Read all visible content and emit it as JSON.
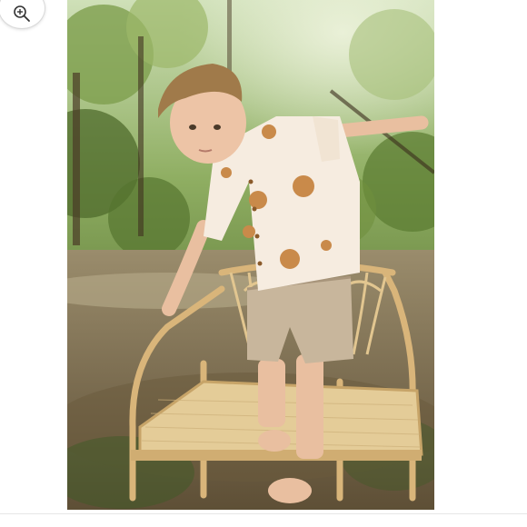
{
  "viewer": {
    "zoom_button": {
      "icon": "zoom-in-icon"
    },
    "image": {
      "alt": "",
      "subject_icon": "photo"
    }
  },
  "colors": {
    "background": "#ffffff",
    "foliage_dark": "#3f5a22",
    "foliage_light": "#a9c77a",
    "ground": "#7a6a4a",
    "rattan": "#d9b57a",
    "shirt": "#f6ece0",
    "flower": "#c98a4a",
    "shorts": "#c8b69c",
    "skin": "#e9bfa0",
    "hair": "#a07a4a"
  }
}
